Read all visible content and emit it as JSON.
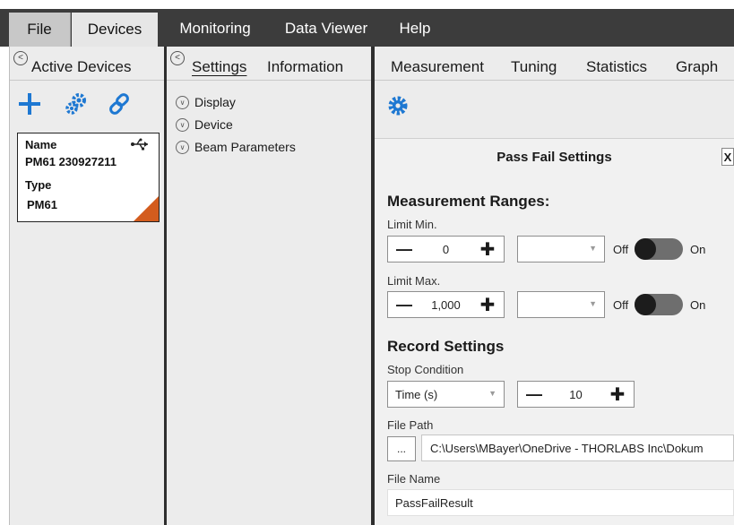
{
  "menu": {
    "file": "File",
    "devices": "Devices",
    "monitoring": "Monitoring",
    "data_viewer": "Data Viewer",
    "help": "Help"
  },
  "devices_panel": {
    "title": "Active Devices",
    "card": {
      "name_label": "Name",
      "name_value": "PM61 230927211",
      "type_label": "Type",
      "type_value": "PM61"
    },
    "icons": [
      "add-icon",
      "gears-icon",
      "link-icon",
      "usb-icon"
    ]
  },
  "settings_panel": {
    "tab_settings": "Settings",
    "tab_information": "Information",
    "tree": [
      "Display",
      "Device",
      "Beam Parameters"
    ]
  },
  "measurement_panel": {
    "tabs": [
      "Measurement",
      "Tuning",
      "Statistics",
      "Graph"
    ],
    "pass_fail": {
      "title": "Pass Fail Settings",
      "close_label": "X",
      "measurement_ranges_title": "Measurement Ranges:",
      "limit_min_label": "Limit Min.",
      "limit_min_value": "0",
      "limit_max_label": "Limit Max.",
      "limit_max_value": "1,000",
      "off_label": "Off",
      "on_label": "On",
      "record_settings_title": "Record Settings",
      "stop_condition_label": "Stop Condition",
      "stop_condition_value": "Time (s)",
      "stop_value": "10",
      "file_path_label": "File Path",
      "browse_label": "...",
      "file_path_value": "C:\\Users\\MBayer\\OneDrive - THORLABS Inc\\Dokum",
      "file_name_label": "File Name",
      "file_name_value": "PassFailResult"
    }
  },
  "colors": {
    "menubar": "#3c3c3c",
    "accent_blue": "#1e78d2",
    "device_corner": "#d35c1e"
  }
}
